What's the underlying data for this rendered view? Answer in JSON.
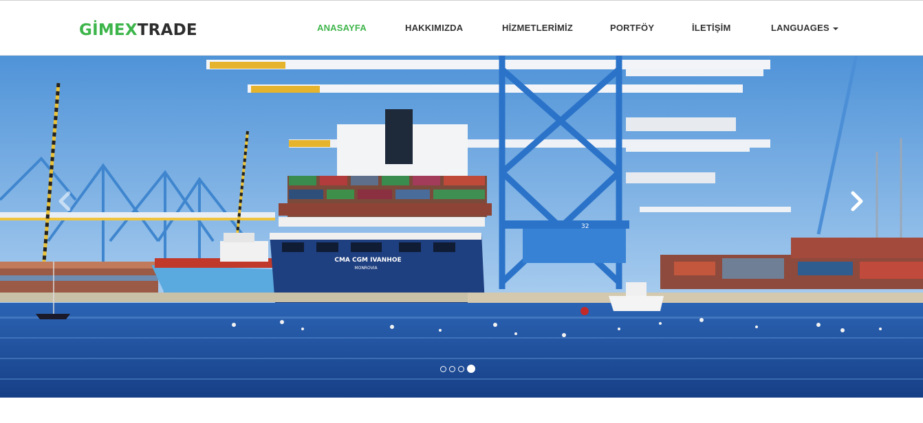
{
  "brand": {
    "part1": "GİMEX",
    "part2": "TRADE",
    "accent_color": "#3db54a"
  },
  "nav": {
    "items": [
      {
        "label": "ANASAYFA",
        "active": true
      },
      {
        "label": "HAKKIMIZDA",
        "active": false
      },
      {
        "label": "HİZMETLERİMİZ",
        "active": false
      },
      {
        "label": "PORTFÖY",
        "active": false
      },
      {
        "label": "İLETİŞİM",
        "active": false
      },
      {
        "label": "LANGUAGES",
        "active": false,
        "dropdown": true
      }
    ]
  },
  "slider": {
    "ship_name": "CMA CGM IVANHOE",
    "ship_port": "MONROVIA",
    "crane_number": "32",
    "prev_icon": "chevron-left-icon",
    "next_icon": "chevron-right-icon",
    "slide_count": 4,
    "active_slide": 4
  }
}
